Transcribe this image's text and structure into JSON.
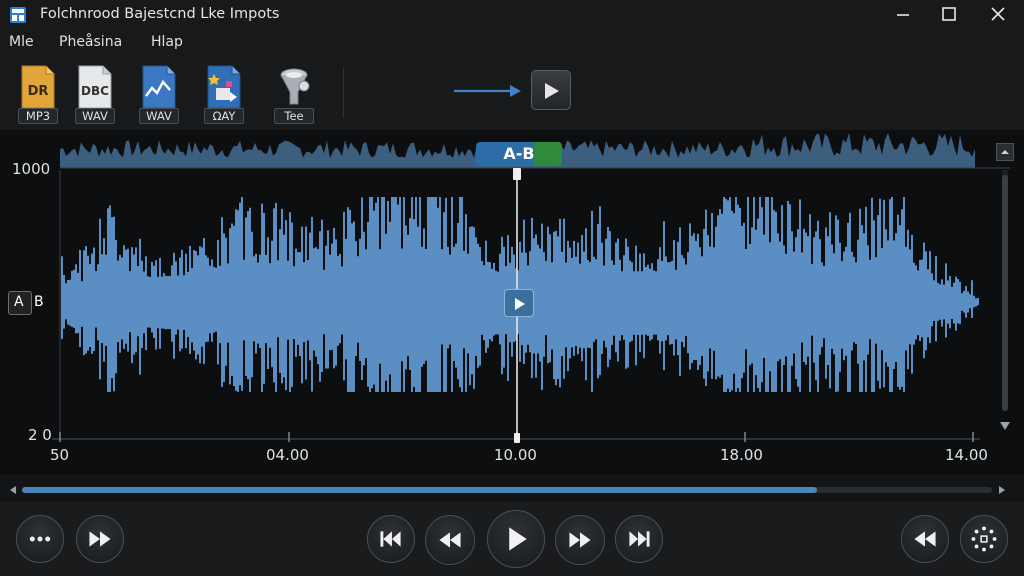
{
  "window": {
    "title": "Folchnrood Bajestcnd Lke Impots"
  },
  "menu": [
    "Mle",
    "Pheåsina",
    "Hlap"
  ],
  "toolbar": {
    "tools": [
      {
        "icon": "mp3-file-icon",
        "glyph": "DR",
        "label": "MP3"
      },
      {
        "icon": "doc-file-icon",
        "glyph": "DBC",
        "label": "WAV"
      },
      {
        "icon": "wav-wave-icon",
        "glyph": "",
        "label": "WAV"
      },
      {
        "icon": "effects-file-icon",
        "glyph": "",
        "label": "ΩAY"
      },
      {
        "icon": "filter-funnel-icon",
        "glyph": "",
        "label": "Tee"
      }
    ],
    "play_icon": "play-icon"
  },
  "waveform": {
    "ab_marker_label": "A-B",
    "ab_side_left": "A",
    "ab_side_right": "B",
    "y_labels": [
      "1000",
      "2 0"
    ],
    "x_labels": [
      "50",
      "04.00",
      "10.00",
      "18.00",
      "14.00"
    ],
    "colors": {
      "wave": "#5b8fc4",
      "overview": "#3c5f80",
      "ab_blue": "#2c6da8",
      "ab_green": "#2f8a3c"
    }
  },
  "scroll": {
    "position_fraction": 0.82
  },
  "transport": {
    "buttons": [
      {
        "icon": "more-options-icon"
      },
      {
        "icon": "fast-forward-icon"
      },
      {
        "icon": "skip-to-start-icon"
      },
      {
        "icon": "rewind-icon"
      },
      {
        "icon": "play-icon"
      },
      {
        "icon": "fast-forward-icon"
      },
      {
        "icon": "skip-to-end-icon"
      },
      {
        "icon": "rewind-icon"
      },
      {
        "icon": "settings-icon"
      }
    ]
  }
}
